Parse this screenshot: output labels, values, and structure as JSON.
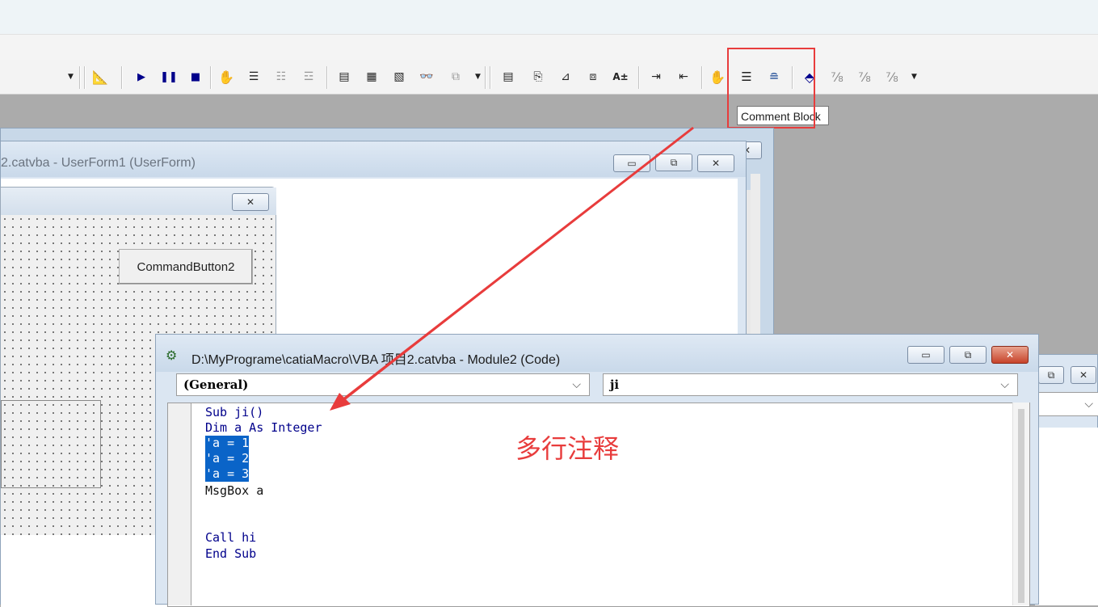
{
  "toolbar": {
    "groups": [
      {
        "name": "design-mode",
        "glyph": "📐"
      },
      {
        "name": "run",
        "glyph": "▶"
      },
      {
        "name": "break",
        "glyph": "⏸"
      },
      {
        "name": "reset",
        "glyph": "■"
      }
    ],
    "tooltip": "Comment Block"
  },
  "userform_window": {
    "title": "2.catvba - UserForm1 (UserForm)",
    "form_close_glyph": "✕",
    "command_button_label": "CommandButton2"
  },
  "code_window": {
    "title": "D:\\MyPrograme\\catiaMacro\\VBA 项目2.catvba - Module2 (Code)",
    "object_combo": "(General)",
    "procedure_combo": "ji",
    "lines": [
      {
        "text": "Sub ji()",
        "style": "kw"
      },
      {
        "text": "Dim a As Integer",
        "style": "kw"
      },
      {
        "text": "'a = 1",
        "style": "sel"
      },
      {
        "text": "'a = 2",
        "style": "sel"
      },
      {
        "text": "'a = 3",
        "style": "sel"
      },
      {
        "text": "MsgBox a",
        "style": "plain"
      },
      {
        "text": "",
        "style": "plain"
      },
      {
        "text": "",
        "style": "plain"
      },
      {
        "text": "Call hi",
        "style": "kw"
      },
      {
        "text": "End Sub",
        "style": "kw"
      }
    ]
  },
  "annotation": {
    "text": "多行注释",
    "color": "#e83c3c"
  },
  "colors": {
    "accent_red": "#e83c3c",
    "selection": "#0a64c8",
    "keyword": "#00008b"
  }
}
